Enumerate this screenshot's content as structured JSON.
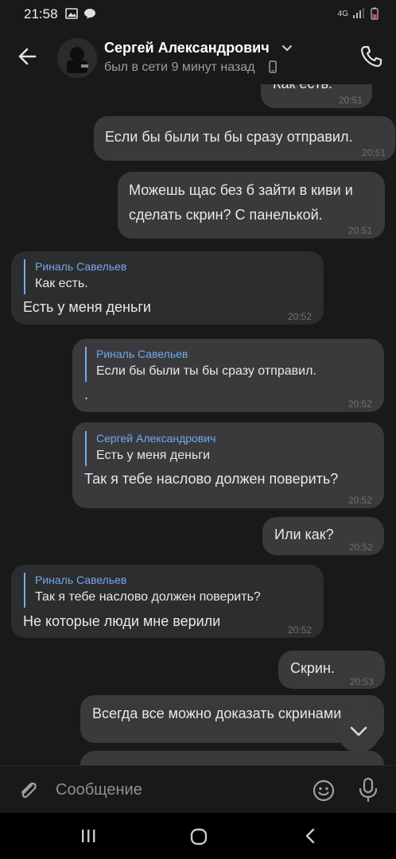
{
  "status_bar": {
    "time": "21:58",
    "network": "4G"
  },
  "header": {
    "contact_name": "Сергей Александрович",
    "status": "был в сети 9 минут назад"
  },
  "messages": [
    {
      "dir": "out",
      "text": "Как есть.",
      "time": "20:51"
    },
    {
      "dir": "out",
      "text": "Если бы были ты бы сразу отправил.",
      "time": "20:51"
    },
    {
      "dir": "out",
      "text": "Можешь щас без б зайти в киви и\nсделать скрин? С панелькой.",
      "time": "20:51"
    },
    {
      "dir": "in",
      "reply_author": "Риналь Савельев",
      "reply_text": "Как есть.",
      "text": "Есть у меня деньги",
      "time": "20:52"
    },
    {
      "dir": "out",
      "reply_author": "Риналь Савельев",
      "reply_text": "Если бы были ты бы сразу отправил.",
      "text": ".",
      "time": "20:52"
    },
    {
      "dir": "out",
      "reply_author": "Сергей Александрович",
      "reply_text": "Есть у меня деньги",
      "text": "Так я тебе наслово должен поверить?",
      "time": "20:52"
    },
    {
      "dir": "out",
      "text": "Или как?",
      "time": "20:52"
    },
    {
      "dir": "in",
      "reply_author": "Риналь Савельев",
      "reply_text": "Так я тебе наслово должен поверить?",
      "text": "Не которые люди мне верили",
      "time": "20:52"
    },
    {
      "dir": "out",
      "text": "Скрин.",
      "time": "20:53"
    },
    {
      "dir": "out",
      "text": "Всегда все можно доказать скринами",
      "time": ""
    },
    {
      "dir": "out",
      "text": "",
      "time": ""
    }
  ],
  "composer": {
    "placeholder": "Сообщение"
  },
  "colors": {
    "background": "#19191a",
    "bubble_out": "#3a3a3c",
    "bubble_in": "#2c2d2e",
    "accent": "#71aaeb"
  }
}
